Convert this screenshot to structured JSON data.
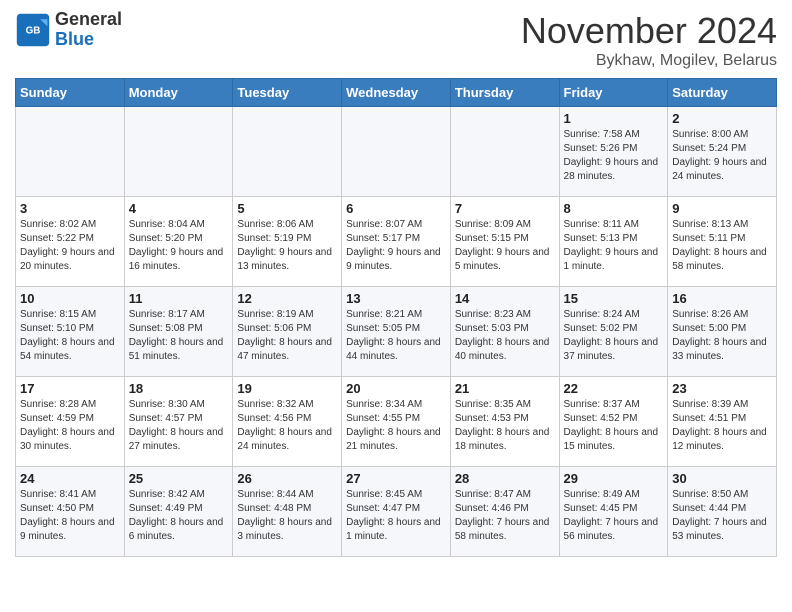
{
  "header": {
    "logo_line1": "General",
    "logo_line2": "Blue",
    "month_title": "November 2024",
    "location": "Bykhaw, Mogilev, Belarus"
  },
  "weekdays": [
    "Sunday",
    "Monday",
    "Tuesday",
    "Wednesday",
    "Thursday",
    "Friday",
    "Saturday"
  ],
  "weeks": [
    [
      {
        "day": "",
        "info": ""
      },
      {
        "day": "",
        "info": ""
      },
      {
        "day": "",
        "info": ""
      },
      {
        "day": "",
        "info": ""
      },
      {
        "day": "",
        "info": ""
      },
      {
        "day": "1",
        "info": "Sunrise: 7:58 AM\nSunset: 5:26 PM\nDaylight: 9 hours and 28 minutes."
      },
      {
        "day": "2",
        "info": "Sunrise: 8:00 AM\nSunset: 5:24 PM\nDaylight: 9 hours and 24 minutes."
      }
    ],
    [
      {
        "day": "3",
        "info": "Sunrise: 8:02 AM\nSunset: 5:22 PM\nDaylight: 9 hours and 20 minutes."
      },
      {
        "day": "4",
        "info": "Sunrise: 8:04 AM\nSunset: 5:20 PM\nDaylight: 9 hours and 16 minutes."
      },
      {
        "day": "5",
        "info": "Sunrise: 8:06 AM\nSunset: 5:19 PM\nDaylight: 9 hours and 13 minutes."
      },
      {
        "day": "6",
        "info": "Sunrise: 8:07 AM\nSunset: 5:17 PM\nDaylight: 9 hours and 9 minutes."
      },
      {
        "day": "7",
        "info": "Sunrise: 8:09 AM\nSunset: 5:15 PM\nDaylight: 9 hours and 5 minutes."
      },
      {
        "day": "8",
        "info": "Sunrise: 8:11 AM\nSunset: 5:13 PM\nDaylight: 9 hours and 1 minute."
      },
      {
        "day": "9",
        "info": "Sunrise: 8:13 AM\nSunset: 5:11 PM\nDaylight: 8 hours and 58 minutes."
      }
    ],
    [
      {
        "day": "10",
        "info": "Sunrise: 8:15 AM\nSunset: 5:10 PM\nDaylight: 8 hours and 54 minutes."
      },
      {
        "day": "11",
        "info": "Sunrise: 8:17 AM\nSunset: 5:08 PM\nDaylight: 8 hours and 51 minutes."
      },
      {
        "day": "12",
        "info": "Sunrise: 8:19 AM\nSunset: 5:06 PM\nDaylight: 8 hours and 47 minutes."
      },
      {
        "day": "13",
        "info": "Sunrise: 8:21 AM\nSunset: 5:05 PM\nDaylight: 8 hours and 44 minutes."
      },
      {
        "day": "14",
        "info": "Sunrise: 8:23 AM\nSunset: 5:03 PM\nDaylight: 8 hours and 40 minutes."
      },
      {
        "day": "15",
        "info": "Sunrise: 8:24 AM\nSunset: 5:02 PM\nDaylight: 8 hours and 37 minutes."
      },
      {
        "day": "16",
        "info": "Sunrise: 8:26 AM\nSunset: 5:00 PM\nDaylight: 8 hours and 33 minutes."
      }
    ],
    [
      {
        "day": "17",
        "info": "Sunrise: 8:28 AM\nSunset: 4:59 PM\nDaylight: 8 hours and 30 minutes."
      },
      {
        "day": "18",
        "info": "Sunrise: 8:30 AM\nSunset: 4:57 PM\nDaylight: 8 hours and 27 minutes."
      },
      {
        "day": "19",
        "info": "Sunrise: 8:32 AM\nSunset: 4:56 PM\nDaylight: 8 hours and 24 minutes."
      },
      {
        "day": "20",
        "info": "Sunrise: 8:34 AM\nSunset: 4:55 PM\nDaylight: 8 hours and 21 minutes."
      },
      {
        "day": "21",
        "info": "Sunrise: 8:35 AM\nSunset: 4:53 PM\nDaylight: 8 hours and 18 minutes."
      },
      {
        "day": "22",
        "info": "Sunrise: 8:37 AM\nSunset: 4:52 PM\nDaylight: 8 hours and 15 minutes."
      },
      {
        "day": "23",
        "info": "Sunrise: 8:39 AM\nSunset: 4:51 PM\nDaylight: 8 hours and 12 minutes."
      }
    ],
    [
      {
        "day": "24",
        "info": "Sunrise: 8:41 AM\nSunset: 4:50 PM\nDaylight: 8 hours and 9 minutes."
      },
      {
        "day": "25",
        "info": "Sunrise: 8:42 AM\nSunset: 4:49 PM\nDaylight: 8 hours and 6 minutes."
      },
      {
        "day": "26",
        "info": "Sunrise: 8:44 AM\nSunset: 4:48 PM\nDaylight: 8 hours and 3 minutes."
      },
      {
        "day": "27",
        "info": "Sunrise: 8:45 AM\nSunset: 4:47 PM\nDaylight: 8 hours and 1 minute."
      },
      {
        "day": "28",
        "info": "Sunrise: 8:47 AM\nSunset: 4:46 PM\nDaylight: 7 hours and 58 minutes."
      },
      {
        "day": "29",
        "info": "Sunrise: 8:49 AM\nSunset: 4:45 PM\nDaylight: 7 hours and 56 minutes."
      },
      {
        "day": "30",
        "info": "Sunrise: 8:50 AM\nSunset: 4:44 PM\nDaylight: 7 hours and 53 minutes."
      }
    ]
  ]
}
